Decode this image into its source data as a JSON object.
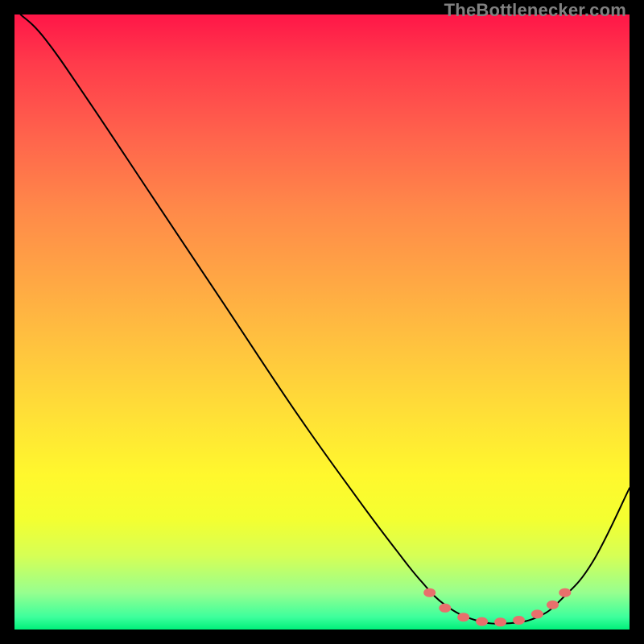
{
  "credit": "TheBottlenecker.com",
  "colors": {
    "background": "#000000",
    "credit_text": "#808080",
    "curve": "#000000",
    "marker": "#e86f6c"
  },
  "chart_data": {
    "type": "line",
    "title": "",
    "xlabel": "",
    "ylabel": "",
    "xlim": [
      0,
      100
    ],
    "ylim": [
      0,
      100
    ],
    "note": "No axes or tick labels are rendered in the image. The black curve starts at the top-left, descends steeply with a slight convex bow to a flat minimum near the bottom around x≈74–84% of width, then rises toward the right edge. Coral markers cluster along the flat bottom and the start of the rising leg.",
    "series": [
      {
        "name": "curve",
        "x": [
          1,
          5,
          12,
          22,
          34,
          46,
          56,
          62,
          66,
          70,
          75,
          80,
          85,
          89,
          94,
          100
        ],
        "y": [
          100,
          96,
          86,
          71,
          53,
          35,
          21,
          13,
          8,
          4,
          1.5,
          1,
          2,
          5,
          11,
          23
        ]
      }
    ],
    "markers": {
      "name": "sweet-spot",
      "x": [
        67.5,
        70,
        73,
        76,
        79,
        82,
        85,
        87.5,
        89.5
      ],
      "y": [
        6,
        3.5,
        2,
        1.3,
        1.2,
        1.5,
        2.5,
        4,
        6
      ]
    }
  }
}
